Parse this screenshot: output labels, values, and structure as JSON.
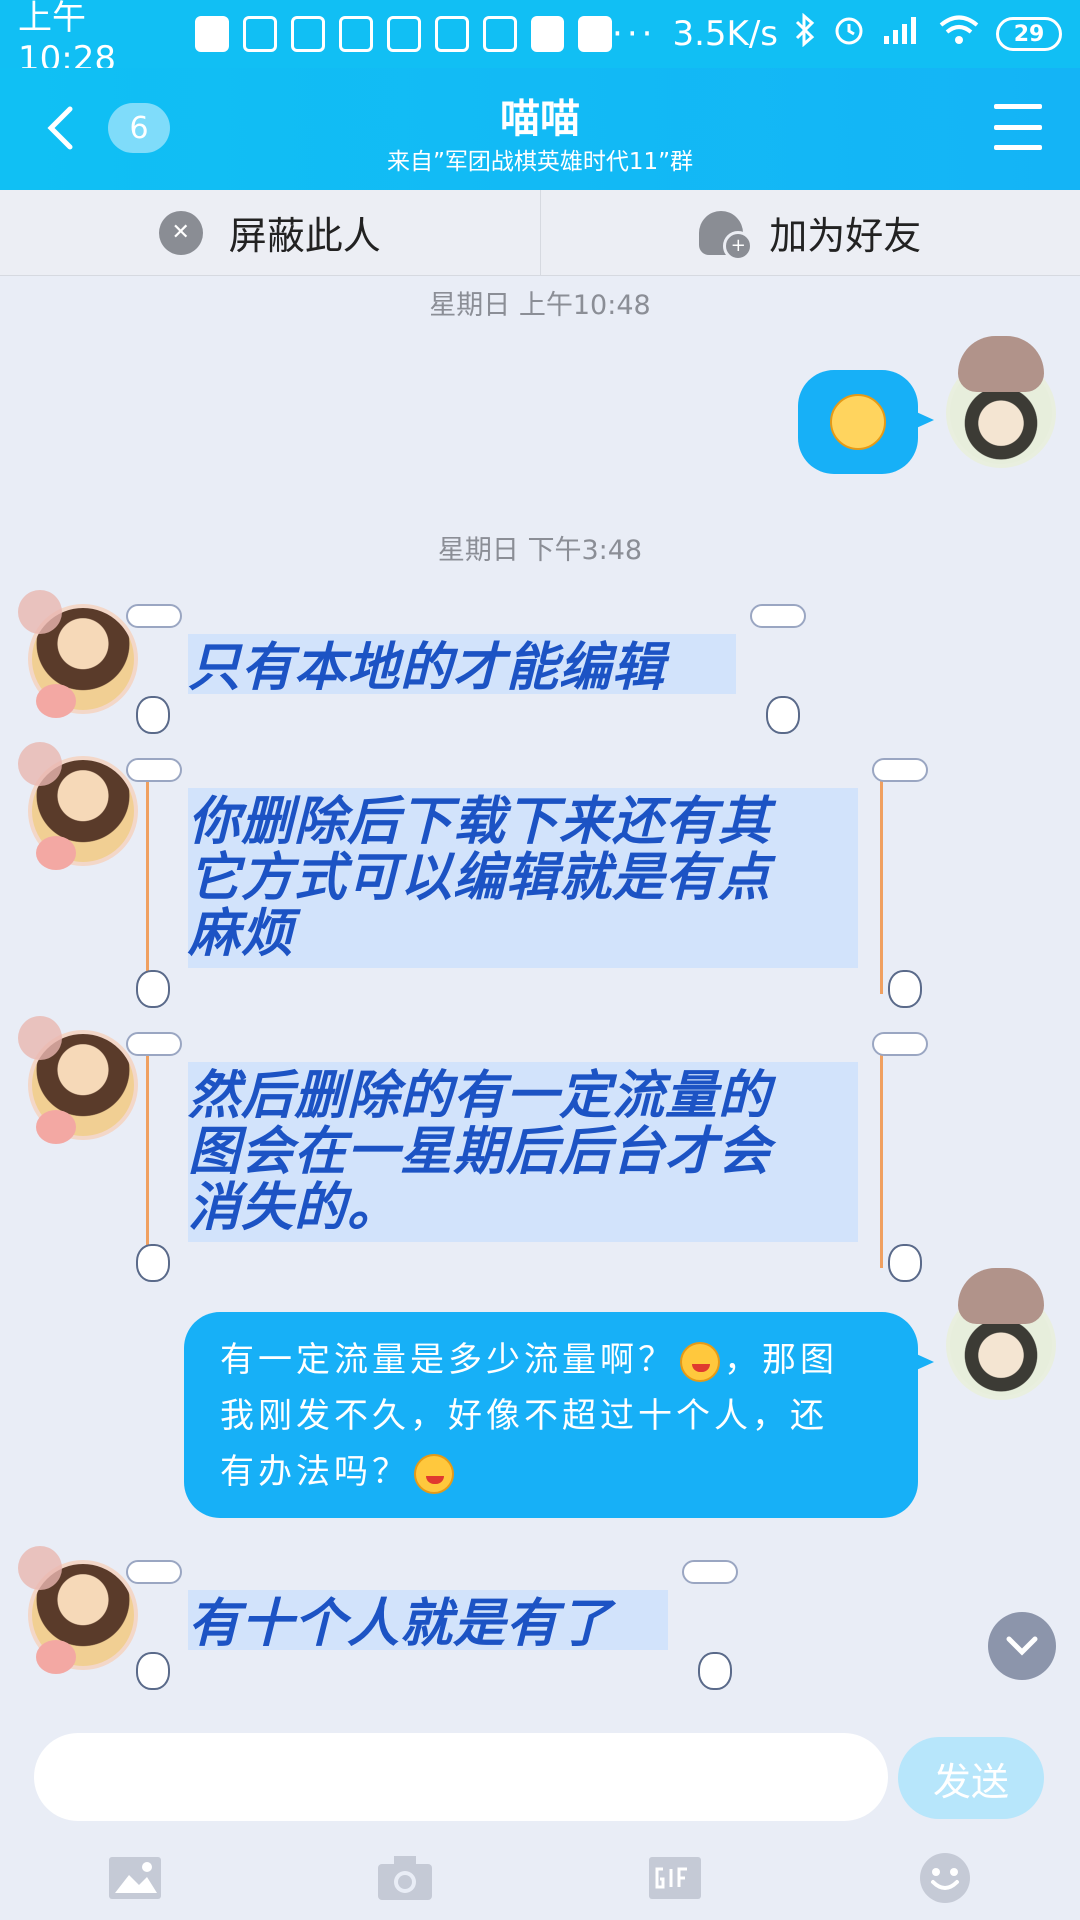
{
  "status_bar": {
    "time": "上午10:28",
    "dots": "···",
    "speed": "3.5K/s",
    "battery": "29"
  },
  "header": {
    "unread_count": "6",
    "title": "喵喵",
    "subtitle": "来自”军团战棋英雄时代11”群"
  },
  "actions": {
    "block_label": "屏蔽此人",
    "add_friend_label": "加为好友"
  },
  "messages": {
    "ts1": "星期日 上午10:48",
    "ts2": "星期日 下午3:48",
    "m2": "只有本地的才能编辑",
    "m3_l1": "你删除后下载下来还有其",
    "m3_l2": "它方式可以编辑就是有点",
    "m3_l3": "麻烦",
    "m4_l1": "然后删除的有一定流量的",
    "m4_l2": "图会在一星期后后台才会",
    "m4_l3": "消失的。",
    "m5_l1a": "有一定流量是多少流量啊？",
    "m5_l1b": "，那图",
    "m5_l2": "我刚发不久，好像不超过十个人，还",
    "m5_l3": "有办法吗？",
    "m6": "有十个人就是有了"
  },
  "input": {
    "send_label": "发送"
  },
  "colors": {
    "header_blue": "#11bff4",
    "outgoing_bubble": "#17b0f7",
    "incoming_text": "#1c53c4",
    "background": "#e9edf6"
  },
  "icons": [
    "back-icon",
    "menu-icon",
    "block-icon",
    "add-friend-icon",
    "confused-emoji-icon",
    "laugh-emoji-icon",
    "chevron-down-icon",
    "image-icon",
    "camera-icon",
    "gif-icon",
    "emoji-icon"
  ]
}
